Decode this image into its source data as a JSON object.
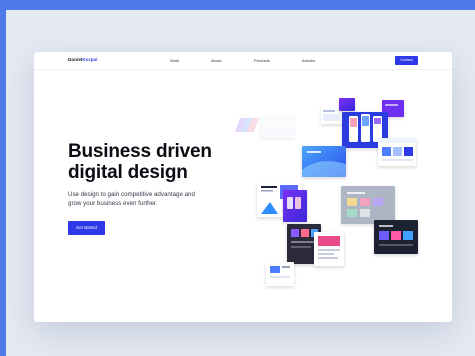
{
  "nav": {
    "logo_main": "Daniel",
    "logo_accent": "Korpai",
    "links": [
      "Work",
      "About",
      "Products",
      "Articles"
    ],
    "contact_label": "Contact"
  },
  "hero": {
    "title_line1": "Business driven",
    "title_line2": "digital design",
    "subtitle_line1": "Use design to gain competitive advantage and",
    "subtitle_line2": "grow your business even further.",
    "cta_label": "Get started"
  },
  "colors": {
    "frame_blue": "#4f7be8",
    "background": "#e4e9f2",
    "brand_blue": "#2d38e8",
    "heading": "#0c0c14"
  }
}
